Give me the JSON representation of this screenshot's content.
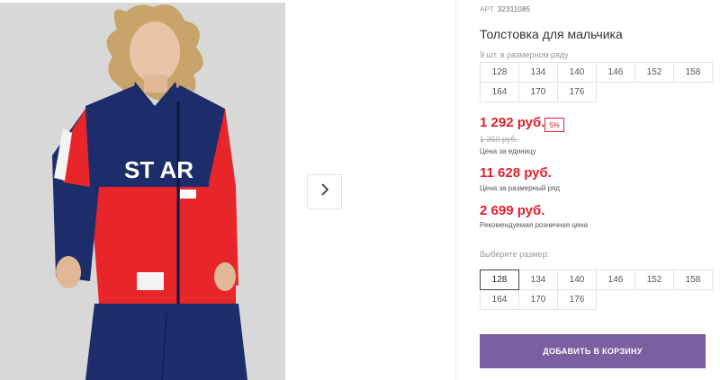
{
  "product": {
    "article_label": "АРТ.",
    "article_value": "32311085",
    "title": "Толстовка для мальчика",
    "image_print_text": "ST AR"
  },
  "size_row": {
    "hint": "9 шт. в размерном ряду",
    "sizes": [
      "128",
      "134",
      "140",
      "146",
      "152",
      "158",
      "164",
      "170",
      "176"
    ]
  },
  "prices": {
    "unit_price": "1 292 руб.",
    "discount": "5%",
    "old_price": "1 360 руб.",
    "unit_caption": "Цена за единицу",
    "row_price": "11 628 руб.",
    "row_caption": "Цена за размерный ряд",
    "retail_price": "2 699 руб.",
    "retail_caption": "Рекомендуемая розничная цена"
  },
  "size_select": {
    "label": "Выберите размер:",
    "sizes": [
      "128",
      "134",
      "140",
      "146",
      "152",
      "158",
      "164",
      "170",
      "176"
    ],
    "selected": "128"
  },
  "cart": {
    "label": "ДОБАВИТЬ В КОРЗИНУ"
  },
  "colors": {
    "accent_red": "#e0202e",
    "button_purple": "#7b5fa0",
    "jacket_navy": "#1d2c6b",
    "jacket_red": "#e8262a"
  },
  "icons": {
    "next": "chevron-right-icon"
  }
}
